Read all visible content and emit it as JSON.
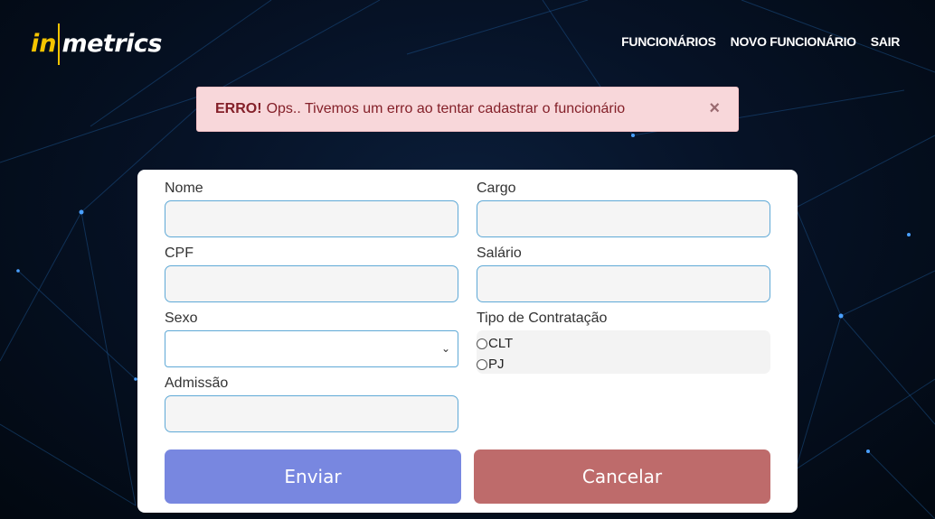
{
  "brand": {
    "logo_in": "in",
    "logo_metrics": "metrics"
  },
  "nav": {
    "items": [
      {
        "label": "FUNCIONÁRIOS"
      },
      {
        "label": "NOVO FUNCIONÁRIO"
      },
      {
        "label": "SAIR"
      }
    ]
  },
  "alert": {
    "title": "ERRO!",
    "message": "Ops.. Tivemos um erro ao tentar cadastrar o funcionário",
    "close": "×"
  },
  "form": {
    "nome_label": "Nome",
    "nome_value": "",
    "cargo_label": "Cargo",
    "cargo_value": "",
    "cpf_label": "CPF",
    "cpf_value": "",
    "salario_label": "Salário",
    "salario_value": "",
    "sexo_label": "Sexo",
    "sexo_selected": "",
    "contratacao_label": "Tipo de Contratação",
    "contratacao_options": [
      "CLT",
      "PJ"
    ],
    "admissao_label": "Admissão",
    "admissao_value": "",
    "submit_label": "Enviar",
    "cancel_label": "Cancelar"
  },
  "colors": {
    "accent_logo": "#f5c400",
    "submit_button": "#7887e0",
    "cancel_button": "#be6b6b",
    "alert_bg": "#f8d7da"
  }
}
